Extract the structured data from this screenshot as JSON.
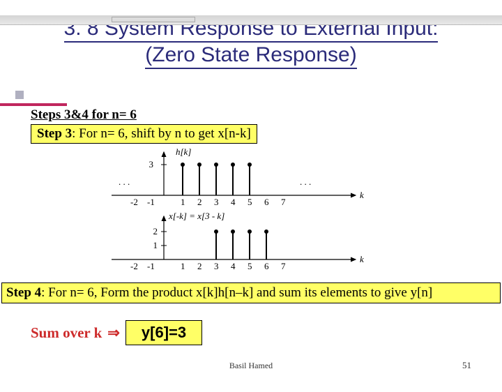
{
  "title_line1": "3. 8 System Response to External Input:",
  "title_line2": "(Zero State Response)",
  "steps_heading": "Steps 3&4 for n= 6",
  "step3": {
    "prefix": "Step 3",
    "rest": ": For n= 6, shift by n to get x[n-k]"
  },
  "step4": {
    "prefix": "Step 4",
    "rest": ": For n= 6, Form the product x[k]h[n–k] and sum its elements to give y[n]"
  },
  "sum_label": "Sum over k",
  "result": "y[6]=3",
  "footer_name": "Basil Hamed",
  "page_number": "51",
  "figure": {
    "top": {
      "func_label": "h[k]",
      "y_tick": "3",
      "axis_label": "k",
      "dots_left": ". . .",
      "dots_right": ". . .",
      "x_ticks": [
        "-2",
        "-1",
        "1",
        "2",
        "3",
        "4",
        "5",
        "6",
        "7"
      ]
    },
    "bottom": {
      "func_label": "x[-k] = x[3 - k]",
      "y_ticks": [
        "2",
        "1"
      ],
      "axis_label": "k",
      "x_ticks": [
        "-2",
        "-1",
        "1",
        "2",
        "3",
        "4",
        "5",
        "6",
        "7"
      ]
    }
  },
  "chart_data": [
    {
      "type": "bar",
      "title": "h[k]",
      "xlabel": "k",
      "ylabel": "",
      "categories": [
        1,
        2,
        3,
        4,
        5
      ],
      "values": [
        3,
        3,
        3,
        3,
        3
      ],
      "ylim": [
        0,
        3
      ]
    },
    {
      "type": "bar",
      "title": "x[-k] = x[3 - k]",
      "xlabel": "k",
      "ylabel": "",
      "categories": [
        3,
        4,
        5,
        6
      ],
      "values": [
        2,
        2,
        2,
        2
      ],
      "ylim": [
        0,
        2
      ]
    }
  ]
}
